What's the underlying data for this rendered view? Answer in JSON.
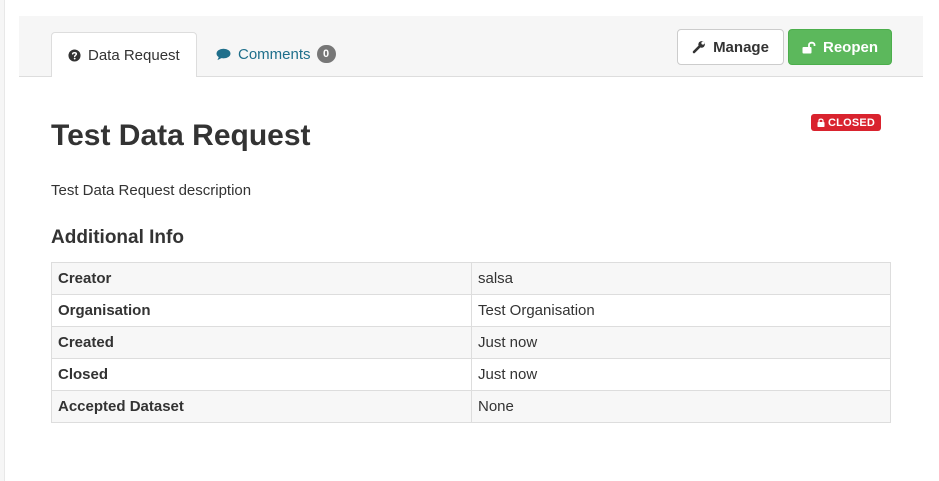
{
  "tabs": {
    "data_request": "Data Request",
    "comments": "Comments",
    "comments_count": "0"
  },
  "actions": {
    "manage_label": "Manage",
    "reopen_label": "Reopen"
  },
  "status": {
    "label": "CLOSED",
    "color": "#d9232e"
  },
  "request": {
    "title": "Test Data Request",
    "description": "Test Data Request description"
  },
  "additional_info": {
    "heading": "Additional Info",
    "rows": [
      {
        "key": "Creator",
        "value": "salsa"
      },
      {
        "key": "Organisation",
        "value": "Test Organisation"
      },
      {
        "key": "Created",
        "value": "Just now"
      },
      {
        "key": "Closed",
        "value": "Just now"
      },
      {
        "key": "Accepted Dataset",
        "value": "None"
      }
    ]
  },
  "colors": {
    "reopen": "#5cb85c",
    "link": "#1f6f8b"
  },
  "icons": {
    "data_request_tab": "question-circle-icon",
    "comments_tab": "comment-icon",
    "manage": "wrench-icon",
    "reopen": "unlock-icon",
    "status": "lock-icon"
  }
}
